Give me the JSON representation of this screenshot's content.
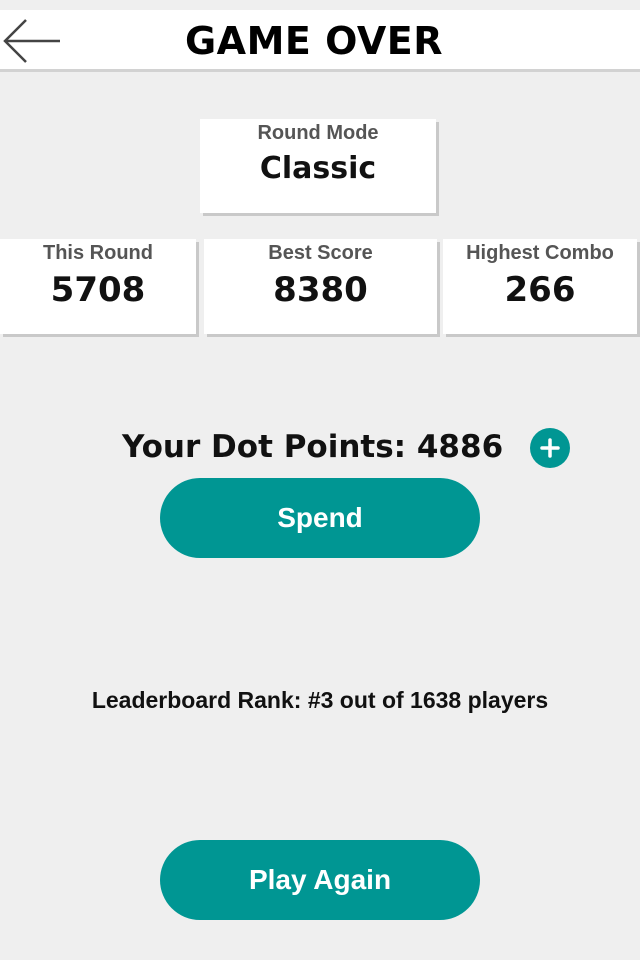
{
  "header": {
    "title": "GAME OVER",
    "back_icon": "arrow-left-icon"
  },
  "round_mode": {
    "label": "Round Mode",
    "value": "Classic"
  },
  "stats": [
    {
      "label": "This Round",
      "value": "5708"
    },
    {
      "label": "Best Score",
      "value": "8380"
    },
    {
      "label": "Highest Combo",
      "value": "266"
    }
  ],
  "dot_points": {
    "text": "Your Dot Points: 4886",
    "add_icon": "plus-icon"
  },
  "spend_button": {
    "label": "Spend"
  },
  "leaderboard": {
    "text": "Leaderboard Rank: #3 out of 1638 players"
  },
  "play_again_button": {
    "label": "Play Again"
  },
  "colors": {
    "accent": "#009693",
    "background": "#efefef",
    "card": "#ffffff"
  }
}
